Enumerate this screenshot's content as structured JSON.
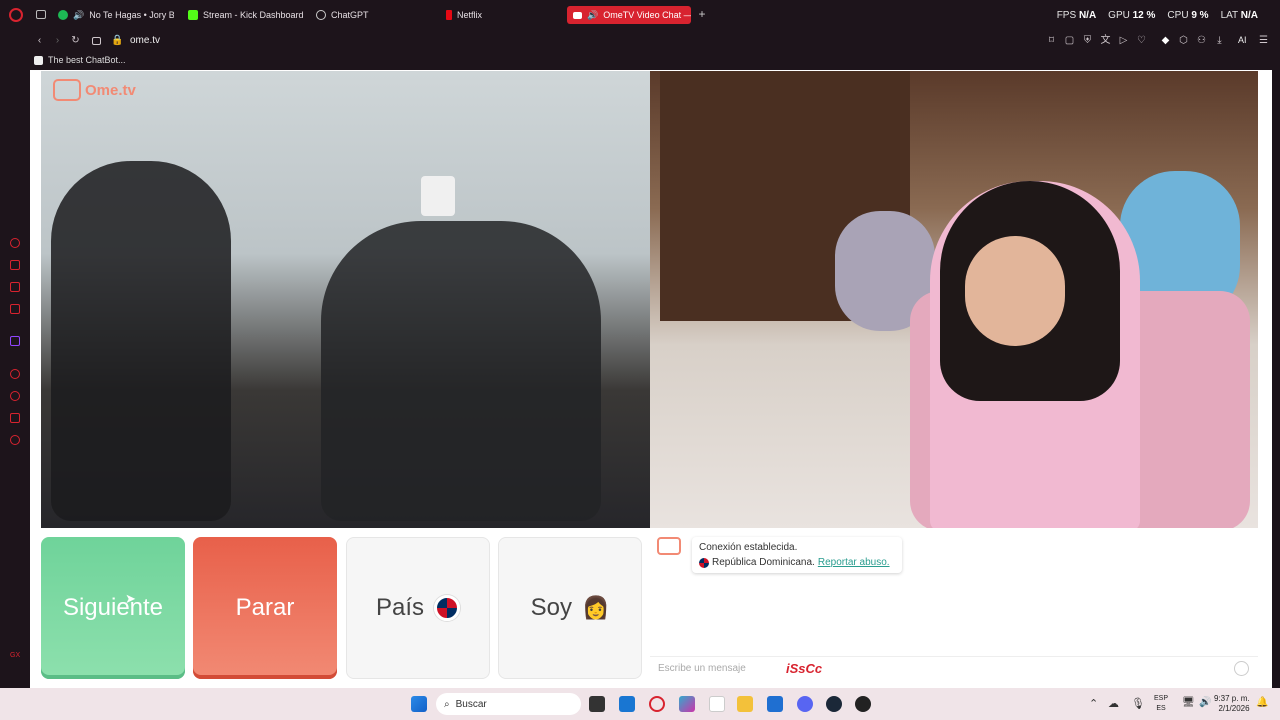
{
  "tabs": [
    {
      "label": "No Te Hagas • Jory Bo",
      "color": "#1db954"
    },
    {
      "label": "Stream - Kick Dashboard",
      "color": "#53fc18"
    },
    {
      "label": "ChatGPT",
      "color": "#bbbbbb"
    },
    {
      "label": "Netflix",
      "color": "#e50914"
    },
    {
      "label": "OmeTV Video Chat —",
      "color": "#ffffff"
    }
  ],
  "system_stats": {
    "fps_label": "FPS",
    "fps_value": "N/A",
    "gpu_label": "GPU",
    "gpu_value": "12 %",
    "cpu_label": "CPU",
    "cpu_value": "9 %",
    "lat_label": "LAT",
    "lat_value": "N/A"
  },
  "address": {
    "url": "ome.tv",
    "ai_label": "AI"
  },
  "bookmarks": [
    {
      "label": "The best ChatBot..."
    }
  ],
  "logo": {
    "text": "Ome.tv"
  },
  "controls": {
    "next_label": "Siguiente",
    "stop_label": "Parar",
    "country_label": "País",
    "gender_label": "Soy"
  },
  "chat": {
    "status": "Conexión establecida.",
    "country": "República Dominicana.",
    "report_link": "Reportar abuso.",
    "input_placeholder": "Escribe un mensaje",
    "overlay_text": "iSsCc"
  },
  "taskbar": {
    "search_placeholder": "Buscar",
    "lang_top": "ESP",
    "lang_bottom": "ES",
    "time": "9:37 p. m.",
    "date": "2/1/2026"
  },
  "colors": {
    "accent": "#d8232f",
    "next": "#6fd39a",
    "stop": "#e8604a"
  }
}
